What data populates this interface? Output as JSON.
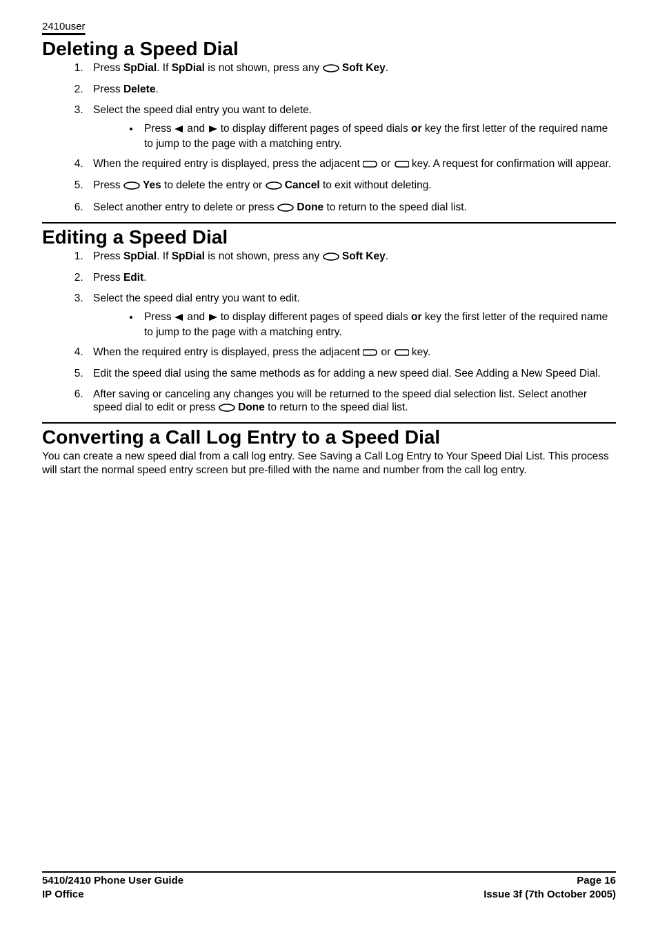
{
  "runningHead": "2410user",
  "sections": {
    "delete": {
      "title": "Deleting a Speed Dial",
      "steps": {
        "s1a": "Press ",
        "s1b": "SpDial",
        "s1c": ". If ",
        "s1d": "SpDial",
        "s1e": " is not shown, press any ",
        "s1f": " Soft Key",
        "s1g": ".",
        "s2a": "Press ",
        "s2b": "Delete",
        "s2c": ".",
        "s3": "Select the speed dial entry you want to delete.",
        "s3sub_a": "Press ",
        "s3sub_b": " and ",
        "s3sub_c": " to display different pages of speed dials ",
        "s3sub_or": "or",
        "s3sub_d": " key the first letter of the required name to jump to the page with a matching entry.",
        "s4a": "When the required entry is displayed, press the adjacent ",
        "s4b": " or ",
        "s4c": " key. A request for confirmation will appear.",
        "s5a": "Press ",
        "s5b": " Yes",
        "s5c": " to delete the entry or ",
        "s5d": " Cancel",
        "s5e": " to exit without deleting.",
        "s6a": "Select another entry to delete or press ",
        "s6b": " Done",
        "s6c": " to return to the speed dial list."
      }
    },
    "edit": {
      "title": "Editing a Speed Dial",
      "steps": {
        "s1a": "Press ",
        "s1b": "SpDial",
        "s1c": ". If ",
        "s1d": "SpDial",
        "s1e": " is not shown, press any ",
        "s1f": " Soft Key",
        "s1g": ".",
        "s2a": "Press ",
        "s2b": "Edit",
        "s2c": ".",
        "s3": "Select the speed dial entry you want to edit.",
        "s3sub_a": "Press ",
        "s3sub_b": " and ",
        "s3sub_c": " to display different pages of speed dials ",
        "s3sub_or": "or",
        "s3sub_d": " key the first letter of the required name to jump to the page with a matching entry.",
        "s4a": "When the required entry is displayed, press the adjacent ",
        "s4b": " or ",
        "s4c": " key.",
        "s5": "Edit the speed dial using the same methods as for adding a new speed dial. See Adding a New Speed Dial.",
        "s6a": "After saving or canceling any changes you will be returned to the speed dial selection list. Select another speed dial to edit or press ",
        "s6b": " Done",
        "s6c": " to return to the speed dial list."
      }
    },
    "convert": {
      "title": "Converting a Call Log Entry to a Speed Dial",
      "body": "You can create a new speed dial from a call log entry. See Saving a Call Log Entry to Your Speed Dial List. This process will start the normal speed entry screen but pre-filled with the name and number from the call log entry."
    }
  },
  "footer": {
    "leftTop": "5410/2410 Phone User Guide",
    "leftBottom": "IP Office",
    "rightTop": "Page 16",
    "rightBottom": "Issue 3f (7th October 2005)"
  }
}
